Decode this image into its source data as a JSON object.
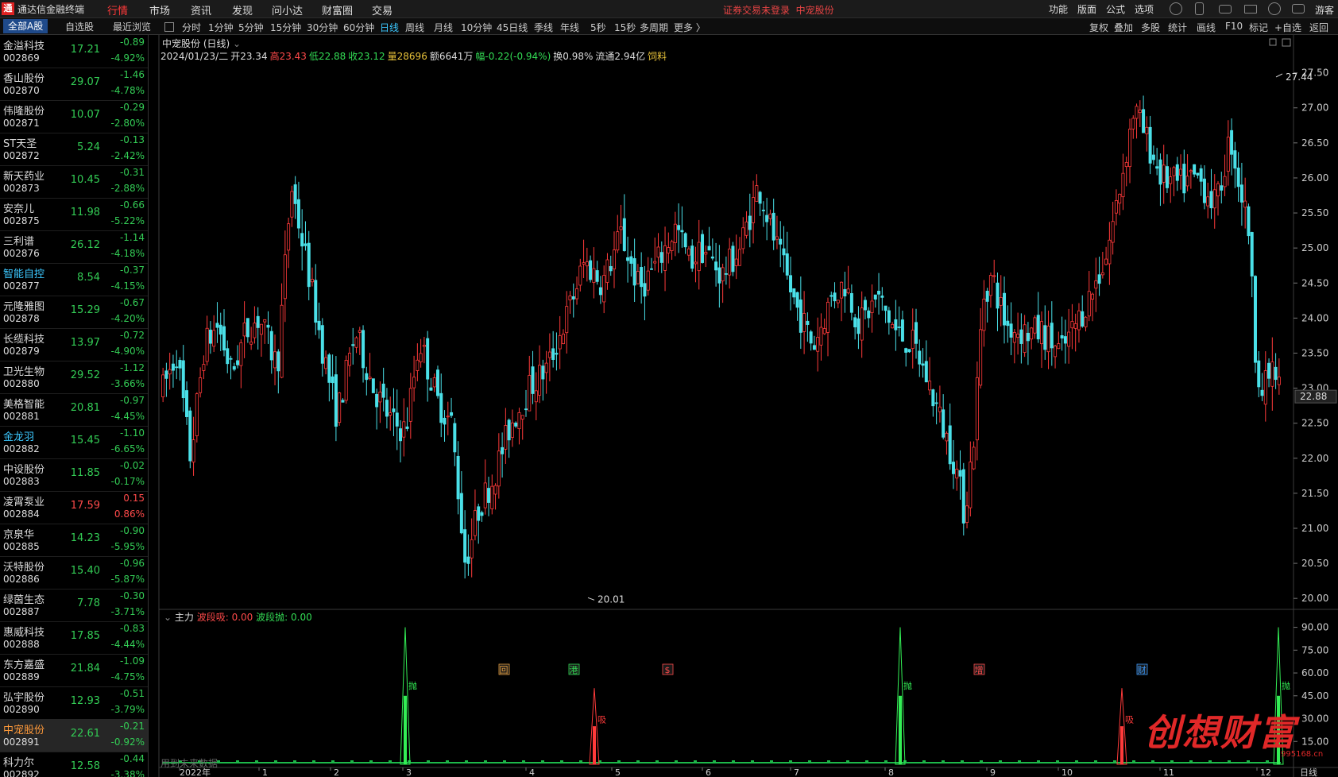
{
  "app": {
    "name": "通达信金融终端",
    "menu": [
      "行情",
      "市场",
      "资讯",
      "发现",
      "问小达",
      "财富圈",
      "交易"
    ],
    "active_menu": "行情",
    "login_note": "证券交易未登录",
    "login_stock": "中宠股份",
    "right_menu": [
      "功能",
      "版面",
      "公式",
      "选项"
    ],
    "guest": "游客"
  },
  "sidebar_tabs": [
    "全部A股",
    "自选股",
    "最近浏览"
  ],
  "period_tabs": [
    "分时",
    "1分钟",
    "5分钟",
    "15分钟",
    "30分钟",
    "60分钟",
    "日线",
    "周线",
    "月线",
    "10分钟",
    "45日线",
    "季线",
    "年线",
    "5秒",
    "15秒",
    "多周期",
    "更多 〉"
  ],
  "active_period": "日线",
  "tools": [
    "复权",
    "叠加",
    "多股",
    "统计",
    "画线",
    "F10",
    "标记",
    "+自选",
    "返回"
  ],
  "stocks": [
    {
      "name": "金溢科技",
      "code": "002869",
      "price": "17.21",
      "chg": "-0.89",
      "pct": "-4.92%",
      "dir": "down"
    },
    {
      "name": "香山股份",
      "code": "002870",
      "price": "29.07",
      "chg": "-1.46",
      "pct": "-4.78%",
      "dir": "down"
    },
    {
      "name": "伟隆股份",
      "code": "002871",
      "price": "10.07",
      "chg": "-0.29",
      "pct": "-2.80%",
      "dir": "down"
    },
    {
      "name": "ST天圣",
      "code": "002872",
      "price": "5.24",
      "chg": "-0.13",
      "pct": "-2.42%",
      "dir": "down"
    },
    {
      "name": "新天药业",
      "code": "002873",
      "price": "10.45",
      "chg": "-0.31",
      "pct": "-2.88%",
      "dir": "down"
    },
    {
      "name": "安奈儿",
      "code": "002875",
      "price": "11.98",
      "chg": "-0.66",
      "pct": "-5.22%",
      "dir": "down"
    },
    {
      "name": "三利谱",
      "code": "002876",
      "price": "26.12",
      "chg": "-1.14",
      "pct": "-4.18%",
      "dir": "down"
    },
    {
      "name": "智能自控",
      "code": "002877",
      "price": "8.54",
      "chg": "-0.37",
      "pct": "-4.15%",
      "dir": "down",
      "hl": true
    },
    {
      "name": "元隆雅图",
      "code": "002878",
      "price": "15.29",
      "chg": "-0.67",
      "pct": "-4.20%",
      "dir": "down"
    },
    {
      "name": "长缆科技",
      "code": "002879",
      "price": "13.97",
      "chg": "-0.72",
      "pct": "-4.90%",
      "dir": "down"
    },
    {
      "name": "卫光生物",
      "code": "002880",
      "price": "29.52",
      "chg": "-1.12",
      "pct": "-3.66%",
      "dir": "down"
    },
    {
      "name": "美格智能",
      "code": "002881",
      "price": "20.81",
      "chg": "-0.97",
      "pct": "-4.45%",
      "dir": "down"
    },
    {
      "name": "金龙羽",
      "code": "002882",
      "price": "15.45",
      "chg": "-1.10",
      "pct": "-6.65%",
      "dir": "down",
      "hl": true
    },
    {
      "name": "中设股份",
      "code": "002883",
      "price": "11.85",
      "chg": "-0.02",
      "pct": "-0.17%",
      "dir": "down"
    },
    {
      "name": "凌霄泵业",
      "code": "002884",
      "price": "17.59",
      "chg": "0.15",
      "pct": "0.86%",
      "dir": "up"
    },
    {
      "name": "京泉华",
      "code": "002885",
      "price": "14.23",
      "chg": "-0.90",
      "pct": "-5.95%",
      "dir": "down"
    },
    {
      "name": "沃特股份",
      "code": "002886",
      "price": "15.40",
      "chg": "-0.96",
      "pct": "-5.87%",
      "dir": "down"
    },
    {
      "name": "绿茵生态",
      "code": "002887",
      "price": "7.78",
      "chg": "-0.30",
      "pct": "-3.71%",
      "dir": "down"
    },
    {
      "name": "惠威科技",
      "code": "002888",
      "price": "17.85",
      "chg": "-0.83",
      "pct": "-4.44%",
      "dir": "down"
    },
    {
      "name": "东方嘉盛",
      "code": "002889",
      "price": "21.84",
      "chg": "-1.09",
      "pct": "-4.75%",
      "dir": "down"
    },
    {
      "name": "弘宇股份",
      "code": "002890",
      "price": "12.93",
      "chg": "-0.51",
      "pct": "-3.79%",
      "dir": "down"
    },
    {
      "name": "中宠股份",
      "code": "002891",
      "price": "22.61",
      "chg": "-0.21",
      "pct": "-0.92%",
      "dir": "down",
      "sel": true
    },
    {
      "name": "科力尔",
      "code": "002892",
      "price": "12.58",
      "chg": "-0.44",
      "pct": "-3.38%",
      "dir": "down"
    }
  ],
  "chart": {
    "title": "中宠股份 (日线)",
    "info": [
      {
        "t": "2024/01/23/二",
        "c": "#dcdcdc"
      },
      {
        "t": "开23.34",
        "c": "#dcdcdc"
      },
      {
        "t": "高23.43",
        "c": "#ff4a4a"
      },
      {
        "t": "低22.88",
        "c": "#33dd55"
      },
      {
        "t": "收23.12",
        "c": "#33dd55"
      },
      {
        "t": "量28696",
        "c": "#e8c23a"
      },
      {
        "t": "额6641万",
        "c": "#dcdcdc"
      },
      {
        "t": "幅-0.22(-0.94%)",
        "c": "#33dd55"
      },
      {
        "t": "换0.98%",
        "c": "#dcdcdc"
      },
      {
        "t": "流通2.94亿",
        "c": "#dcdcdc"
      },
      {
        "t": "饲料",
        "c": "#e8c23a"
      }
    ],
    "current_price": "22.88",
    "high_label": "27.44",
    "low_label": "20.01",
    "x_labels": [
      "2022年",
      "1",
      "2",
      "3",
      "4",
      "5",
      "6",
      "7",
      "8",
      "9",
      "10",
      "11",
      "12",
      "2024/01/23/二"
    ],
    "x_label_right": "日线",
    "event_tags": [
      {
        "t": "回",
        "c": "#e8a040"
      },
      {
        "t": "港",
        "c": "#33dd55"
      },
      {
        "t": "$",
        "c": "#ff4a4a"
      },
      {
        "t": "增",
        "c": "#ff4a4a"
      },
      {
        "t": "财",
        "c": "#3c9cff"
      }
    ]
  },
  "chart_data": [
    {
      "type": "candlestick",
      "title": "中宠股份 (日线)",
      "y_ticks": [
        27.5,
        27.0,
        26.5,
        26.0,
        25.5,
        25.0,
        24.5,
        24.0,
        23.5,
        23.0,
        22.5,
        22.0,
        21.5,
        21.0,
        20.5,
        20.0
      ],
      "ylim": [
        19.9,
        27.7
      ],
      "annotations": [
        {
          "text": "27.44",
          "value": 27.44
        },
        {
          "text": "20.01",
          "value": 20.01
        }
      ],
      "last": {
        "date": "2024/01/23",
        "open": 23.34,
        "high": 23.43,
        "low": 22.88,
        "close": 23.12
      }
    },
    {
      "type": "bar",
      "title": "主力",
      "series": [
        {
          "name": "波段吸",
          "value": 0.0
        },
        {
          "name": "波段抛",
          "value": 0.0
        }
      ],
      "y_ticks": [
        90.0,
        75.0,
        60.0,
        45.0,
        30.0,
        15.0
      ],
      "ylim": [
        0,
        95
      ],
      "signals": [
        {
          "text": "抛",
          "value": 90
        },
        {
          "text": "吸",
          "value": 50
        },
        {
          "text": "抛",
          "value": 90
        },
        {
          "text": "吸",
          "value": 50
        },
        {
          "text": "抛",
          "value": 90
        }
      ]
    }
  ],
  "indicator": {
    "name": "主力",
    "s1": "波段吸: 0.00",
    "s2": "波段抛: 0.00"
  },
  "future_note": "用到未来数据",
  "watermark": {
    "text": "创想财富",
    "url": "995168.cn"
  }
}
